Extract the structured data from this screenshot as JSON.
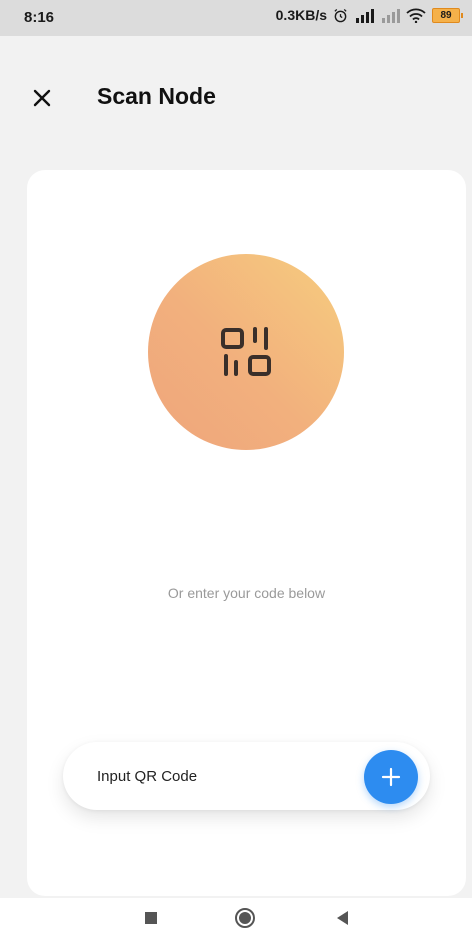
{
  "status_bar": {
    "time": "8:16",
    "net_speed": "0.3KB/s",
    "battery": "89"
  },
  "header": {
    "title": "Scan Node"
  },
  "main": {
    "hint": "Or enter your code below",
    "input": {
      "placeholder": "Input QR Code",
      "value": ""
    }
  },
  "icons": {
    "close": "close-icon",
    "scan": "qr-scan-icon",
    "add": "plus-icon",
    "nav_recents": "square-icon",
    "nav_home": "circle-icon",
    "nav_back": "triangle-back-icon"
  },
  "colors": {
    "accent": "#2d8cf0",
    "scan_gradient_start": "#f6cd7e",
    "scan_gradient_end": "#eea57c",
    "background": "#f2f2f2",
    "card": "#ffffff"
  }
}
